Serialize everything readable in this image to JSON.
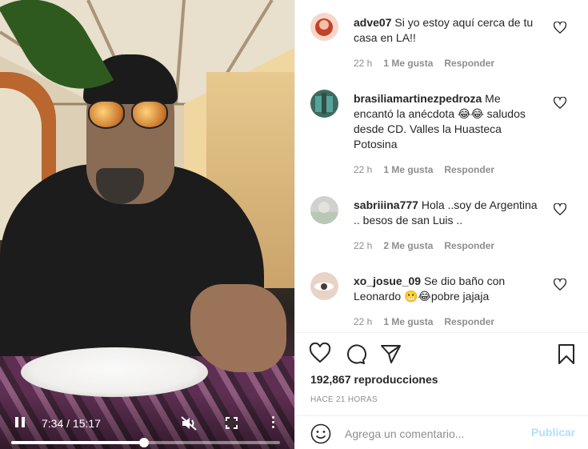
{
  "video": {
    "time": "7:34 / 15:17",
    "progress": 0.494
  },
  "comments": [
    {
      "username": "adve07",
      "text": "Si yo estoy aquí cerca de tu casa en LA!!",
      "time": "22 h",
      "likes": "1 Me gusta",
      "reply": "Responder"
    },
    {
      "username": "brasiliamartinezpedroza",
      "text": "Me encantó la anécdota 😂😂 saludos desde CD. Valles la Huasteca Potosina",
      "time": "22 h",
      "likes": "1 Me gusta",
      "reply": "Responder"
    },
    {
      "username": "sabriiina777",
      "text": "Hola ..soy de Argentina .. besos de san Luis ..",
      "time": "22 h",
      "likes": "2 Me gusta",
      "reply": "Responder"
    },
    {
      "username": "xo_josue_09",
      "text": "Se dio baño con Leonardo 😬😂pobre jajaja",
      "time": "22 h",
      "likes": "1 Me gusta",
      "reply": "Responder"
    }
  ],
  "post": {
    "views": "192,867 reproducciones",
    "posted": "HACE 21 HORAS"
  },
  "compose": {
    "placeholder": "Agrega un comentario...",
    "publish_label": "Publicar"
  },
  "colors": {
    "text": "#262626",
    "muted": "#8e8e8e",
    "publish_disabled": "#b2dffc"
  },
  "icons": [
    "play-pause-icon",
    "mute-icon",
    "fullscreen-icon",
    "more-icon",
    "heart-icon",
    "comment-icon",
    "share-icon",
    "bookmark-icon",
    "emoji-icon"
  ]
}
